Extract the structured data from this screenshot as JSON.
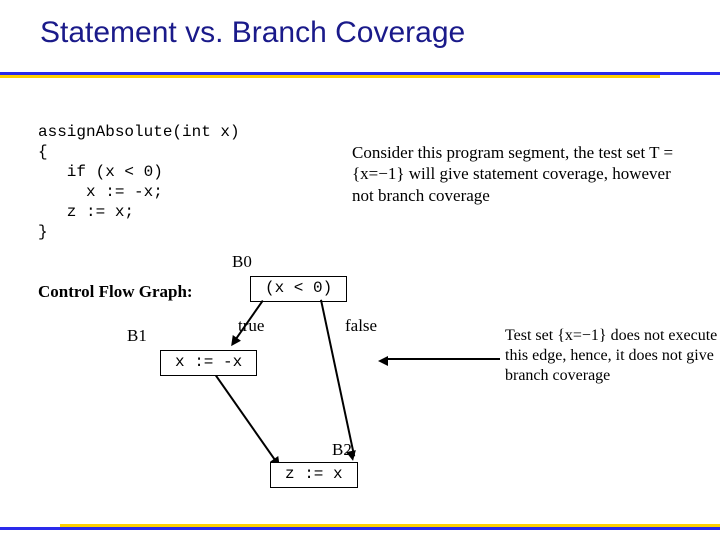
{
  "title": "Statement vs. Branch Coverage",
  "code": "assignAbsolute(int x)\n{\n   if (x < 0)\n     x := -x;\n   z := x;\n}",
  "description": "Consider this program segment, the test set T = {x=−1} will give statement coverage, however not branch coverage",
  "cfg_label": "Control Flow Graph:",
  "nodes": {
    "b0": {
      "label": "B0",
      "content": "(x < 0)"
    },
    "b1": {
      "label": "B1",
      "content": "x := -x"
    },
    "b2": {
      "label": "B2",
      "content": "z := x"
    }
  },
  "edges": {
    "true_label": "true",
    "false_label": "false"
  },
  "annotation": "Test set {x=−1} does not execute this edge, hence, it does not give branch coverage"
}
